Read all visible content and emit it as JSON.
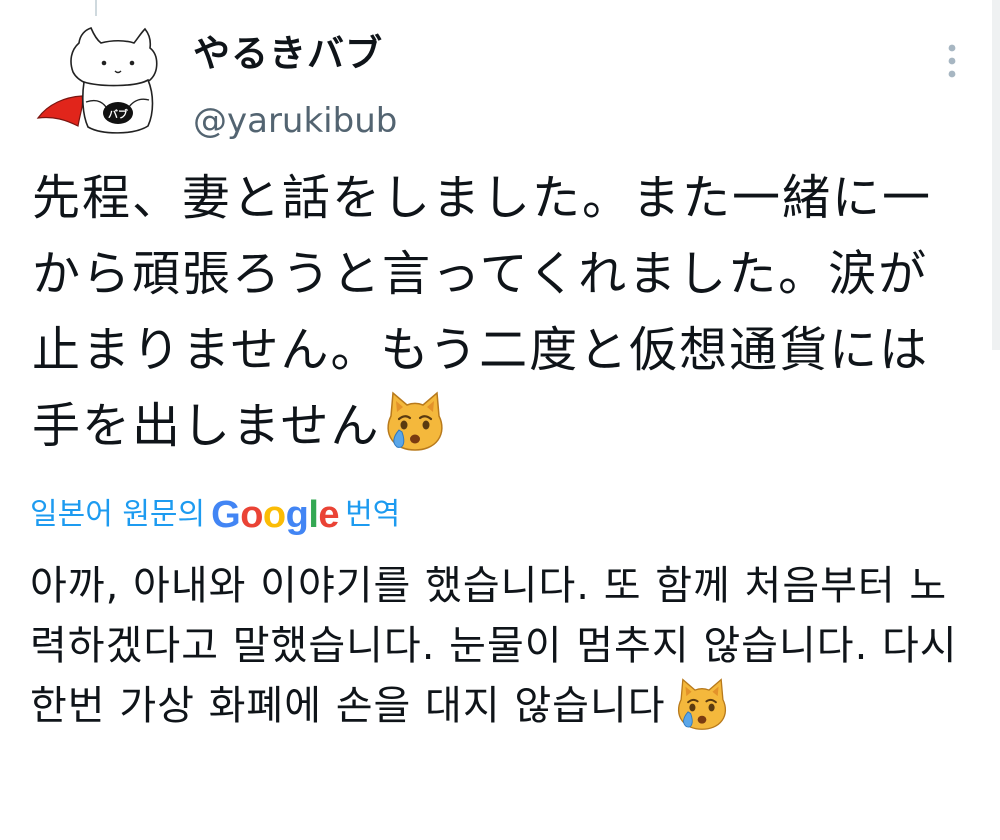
{
  "tweet": {
    "author": {
      "display_name": "やるきバブ",
      "handle": "@yarukibub",
      "avatar_text": "バブ"
    },
    "text": "先程、妻と話をしました。また一緒に一から頑張ろうと言ってくれました。涙が止まりません。もう二度と仮想通貨には手を出しません",
    "text_emoji": "crying-cat-emoji",
    "translation": {
      "label_before": "일본어 원문의",
      "brand": {
        "G": "G",
        "o1": "o",
        "o2": "o",
        "g": "g",
        "l": "l",
        "e": "e"
      },
      "label_after": "번역",
      "text": "아까, 아내와 이야기를 했습니다. 또 함께 처음부터 노력하겠다고 말했습니다. 눈물이 멈추지 않습니다. 다시 한번 가상 화폐에 손을 대지 않습니다",
      "text_emoji": "crying-cat-emoji"
    }
  },
  "icons": {
    "more": "vertical-more-icon",
    "avatar_cape_color": "#e1251b",
    "link_color": "#1d9bf0",
    "google_blue": "#4285f4",
    "google_red": "#ea4335",
    "google_yellow": "#fbbc05",
    "google_green": "#34a853"
  }
}
